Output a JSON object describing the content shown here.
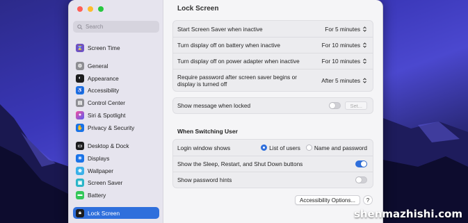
{
  "window": {
    "title": "Lock Screen"
  },
  "sidebar": {
    "search_placeholder": "Search",
    "items": [
      {
        "label": "Screen Time",
        "icon": "hourglass-icon",
        "color": "#6e52c6"
      },
      {
        "label": "General",
        "icon": "gear-icon",
        "color": "#8e8e93"
      },
      {
        "label": "Appearance",
        "icon": "appearance-icon",
        "color": "#1c1c1e"
      },
      {
        "label": "Accessibility",
        "icon": "accessibility-icon",
        "color": "#1a73e8"
      },
      {
        "label": "Control Center",
        "icon": "control-center-icon",
        "color": "#8e8e93"
      },
      {
        "label": "Siri & Spotlight",
        "icon": "siri-icon",
        "color": "#c43fd0"
      },
      {
        "label": "Privacy & Security",
        "icon": "hand-icon",
        "color": "#1a73e8"
      },
      {
        "label": "Desktop & Dock",
        "icon": "dock-icon",
        "color": "#1c1c1e"
      },
      {
        "label": "Displays",
        "icon": "display-icon",
        "color": "#1a73e8"
      },
      {
        "label": "Wallpaper",
        "icon": "wallpaper-icon",
        "color": "#3bb1e8"
      },
      {
        "label": "Screen Saver",
        "icon": "screen-saver-icon",
        "color": "#2bb5c8"
      },
      {
        "label": "Battery",
        "icon": "battery-icon",
        "color": "#34c759"
      },
      {
        "label": "Lock Screen",
        "icon": "lock-icon",
        "color": "#1c1c1e",
        "selected": true
      }
    ]
  },
  "group1": {
    "rows": [
      {
        "label": "Start Screen Saver when inactive",
        "value": "For 5 minutes"
      },
      {
        "label": "Turn display off on battery when inactive",
        "value": "For 10 minutes"
      },
      {
        "label": "Turn display off on power adapter when inactive",
        "value": "For 10 minutes"
      },
      {
        "label": "Require password after screen saver begins or display is turned off",
        "value": "After 5 minutes"
      }
    ]
  },
  "group2": {
    "label": "Show message when locked",
    "toggle_on": false,
    "set_label": "Set..."
  },
  "switching": {
    "heading": "When Switching User",
    "login_label": "Login window shows",
    "options": [
      "List of users",
      "Name and password"
    ],
    "selected_option": "List of users",
    "sleep_label": "Show the Sleep, Restart, and Shut Down buttons",
    "sleep_on": true,
    "hints_label": "Show password hints",
    "hints_on": false
  },
  "footer": {
    "accessibility_button": "Accessibility Options...",
    "help_button": "?"
  },
  "watermark": "shenmazhishi.com",
  "colors": {
    "accent": "#2f6fdc",
    "sidebar_bg": "#e6e4ee",
    "desktop": "#3a37b8"
  }
}
